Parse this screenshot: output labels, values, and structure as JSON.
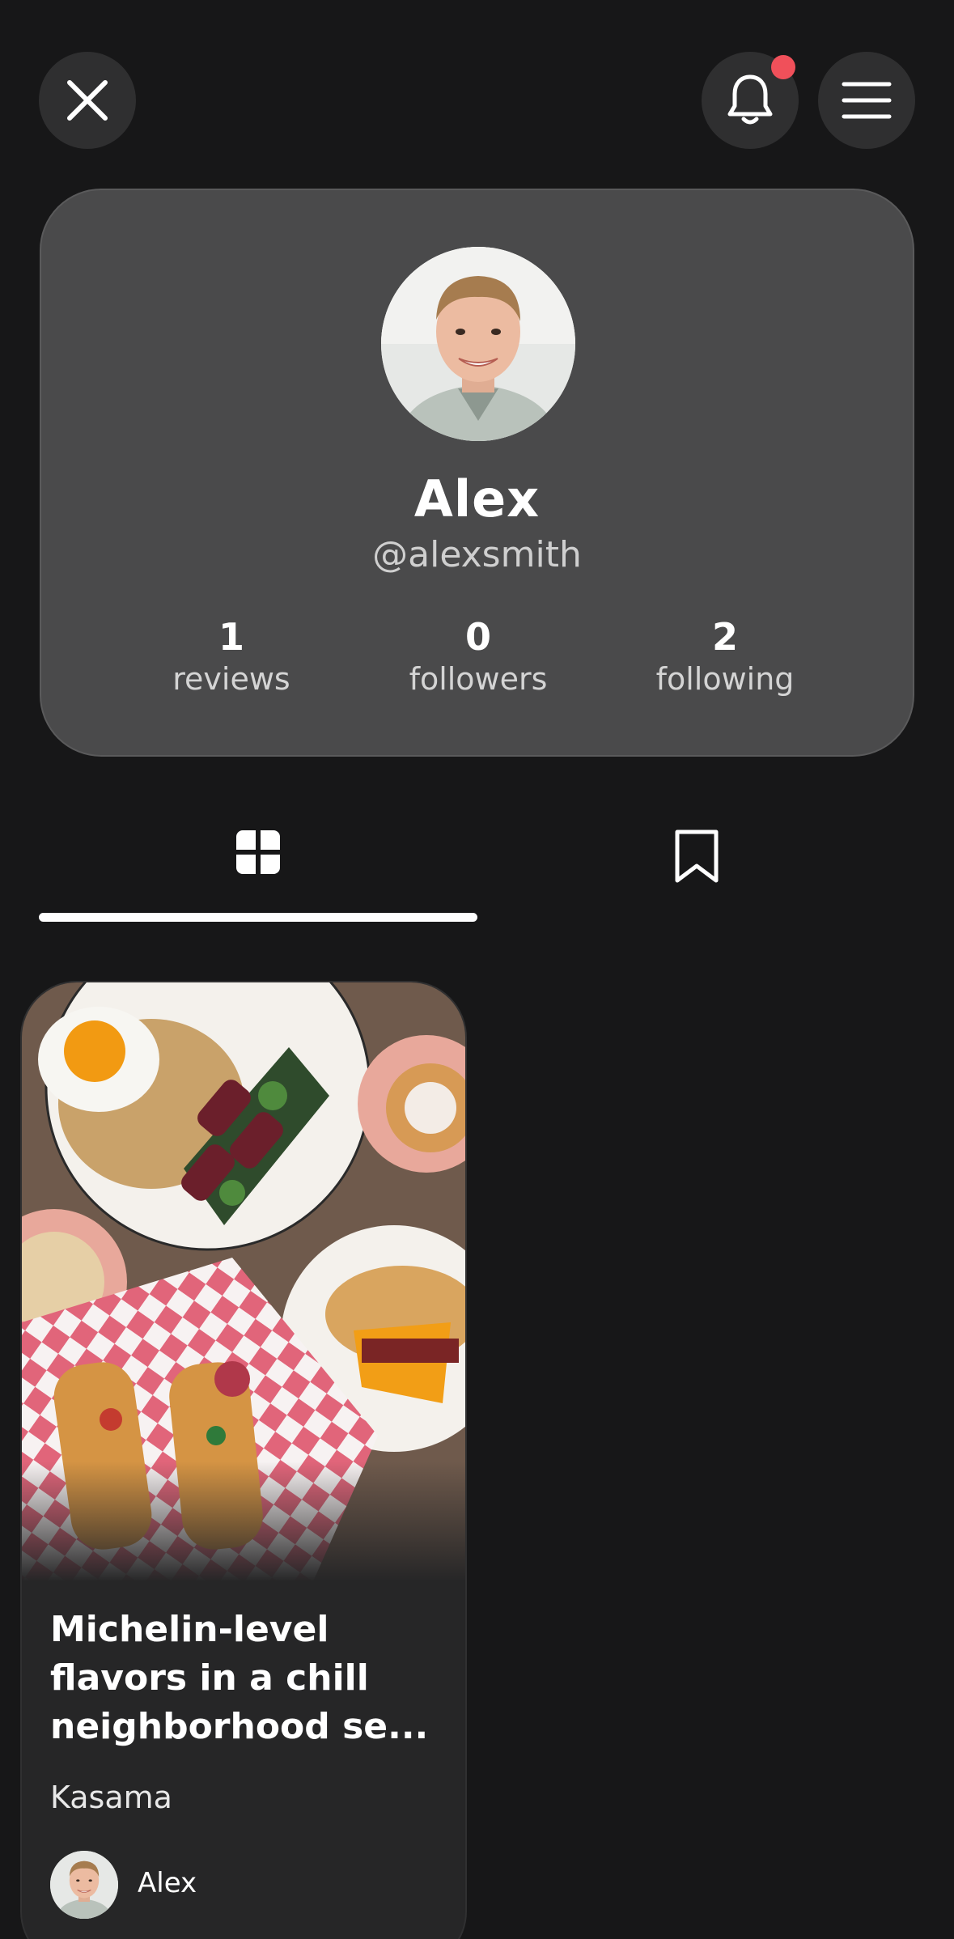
{
  "header": {
    "close_icon": "close-icon",
    "notifications_icon": "bell-icon",
    "notification_dot_color": "#f0505a",
    "menu_icon": "hamburger-menu-icon"
  },
  "profile": {
    "name": "Alex",
    "handle": "@alexsmith",
    "stats": {
      "reviews": {
        "value": "1",
        "label": "reviews"
      },
      "followers": {
        "value": "0",
        "label": "followers"
      },
      "following": {
        "value": "2",
        "label": "following"
      }
    }
  },
  "tabs": [
    {
      "icon": "grid-icon",
      "selected": true
    },
    {
      "icon": "bookmark-icon",
      "selected": false
    }
  ],
  "reviews": [
    {
      "title": "Michelin-level flavors in a chill neighborhood se...",
      "place": "Kasama",
      "author": "Alex"
    }
  ],
  "colors": {
    "background": "#171718",
    "card": "#4a4a4b",
    "accent_dot": "#f0505a"
  }
}
